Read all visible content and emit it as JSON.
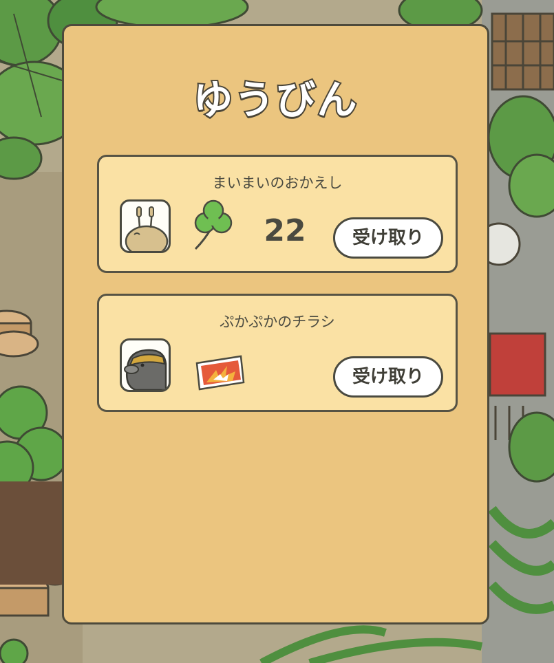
{
  "panel": {
    "title": "ゆうびん"
  },
  "mail": [
    {
      "sender": "まいまいのおかえし",
      "avatar_icon": "snail-avatar-icon",
      "item_icon": "clover-icon",
      "count": "22",
      "button_label": "受け取り"
    },
    {
      "sender": "ぷかぷかのチラシ",
      "avatar_icon": "mole-avatar-icon",
      "item_icon": "flyer-ticket-icon",
      "count": "",
      "button_label": "受け取り"
    }
  ],
  "colors": {
    "panel": "#ebc57f",
    "card": "#fae1a4",
    "outline": "#4d4a3c",
    "button": "#ffffff",
    "clover": "#6fbf52"
  }
}
